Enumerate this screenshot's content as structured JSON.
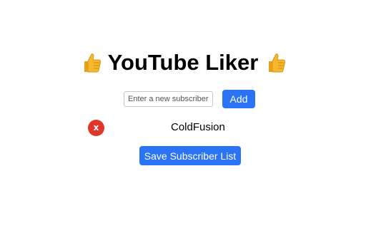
{
  "header": {
    "title": "YouTube Liker",
    "left_icon": "thumbs-up-icon",
    "right_icon": "thumbs-up-icon"
  },
  "form": {
    "input_placeholder": "Enter a new subscriber",
    "input_value": "",
    "add_label": "Add"
  },
  "subscribers": [
    {
      "name": "ColdFusion",
      "remove_label": "x"
    }
  ],
  "actions": {
    "save_label": "Save Subscriber List"
  },
  "colors": {
    "accent": "#2b73f5",
    "remove": "#e0362a",
    "thumb": "#f5b82e"
  }
}
